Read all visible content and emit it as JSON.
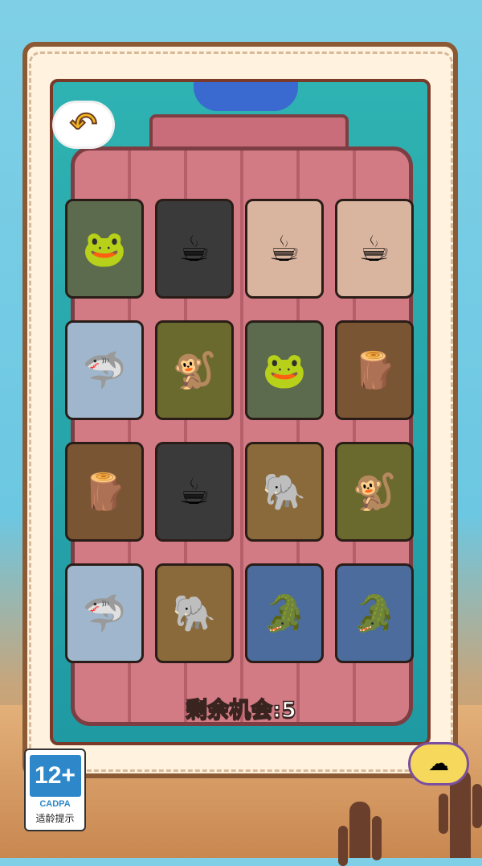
{
  "back_button": {
    "icon": "back-arrow-icon",
    "glyph": "↶"
  },
  "status": {
    "chances_text": "剩余机会:5"
  },
  "age_rating": {
    "age": "12+",
    "org": "CADPA",
    "tip": "适龄提示"
  },
  "mascot": {
    "icon": "cloud-mascot-icon",
    "glyph": "☁"
  },
  "cards": [
    {
      "name": "frog-tire",
      "glyph": "🐸",
      "bg": "#5c6b4e"
    },
    {
      "name": "coffee-cup-robot",
      "glyph": "☕",
      "bg": "#3b3a3a"
    },
    {
      "name": "cappuccino-lady",
      "glyph": "☕",
      "bg": "#d9b5a0"
    },
    {
      "name": "cappuccino-lady",
      "glyph": "☕",
      "bg": "#d9b5a0"
    },
    {
      "name": "shark-sneakers",
      "glyph": "🦈",
      "bg": "#9fb6cc"
    },
    {
      "name": "monkey-banana",
      "glyph": "🐒",
      "bg": "#6b6a2e"
    },
    {
      "name": "frog-tire",
      "glyph": "🐸",
      "bg": "#5c6b4e"
    },
    {
      "name": "wooden-stick-man",
      "glyph": "🪵",
      "bg": "#7a5533"
    },
    {
      "name": "wooden-stick-man",
      "glyph": "🪵",
      "bg": "#7a5533"
    },
    {
      "name": "coffee-cup-robot",
      "glyph": "☕",
      "bg": "#3b3a3a"
    },
    {
      "name": "cactus-elephant",
      "glyph": "🐘",
      "bg": "#8a6a3a"
    },
    {
      "name": "monkey-banana",
      "glyph": "🐒",
      "bg": "#6b6a2e"
    },
    {
      "name": "shark-sneakers",
      "glyph": "🦈",
      "bg": "#9fb6cc"
    },
    {
      "name": "cactus-elephant",
      "glyph": "🐘",
      "bg": "#8a6a3a"
    },
    {
      "name": "crocodile-plane",
      "glyph": "🐊",
      "bg": "#4b6c9c"
    },
    {
      "name": "crocodile-plane",
      "glyph": "🐊",
      "bg": "#4b6c9c"
    }
  ]
}
